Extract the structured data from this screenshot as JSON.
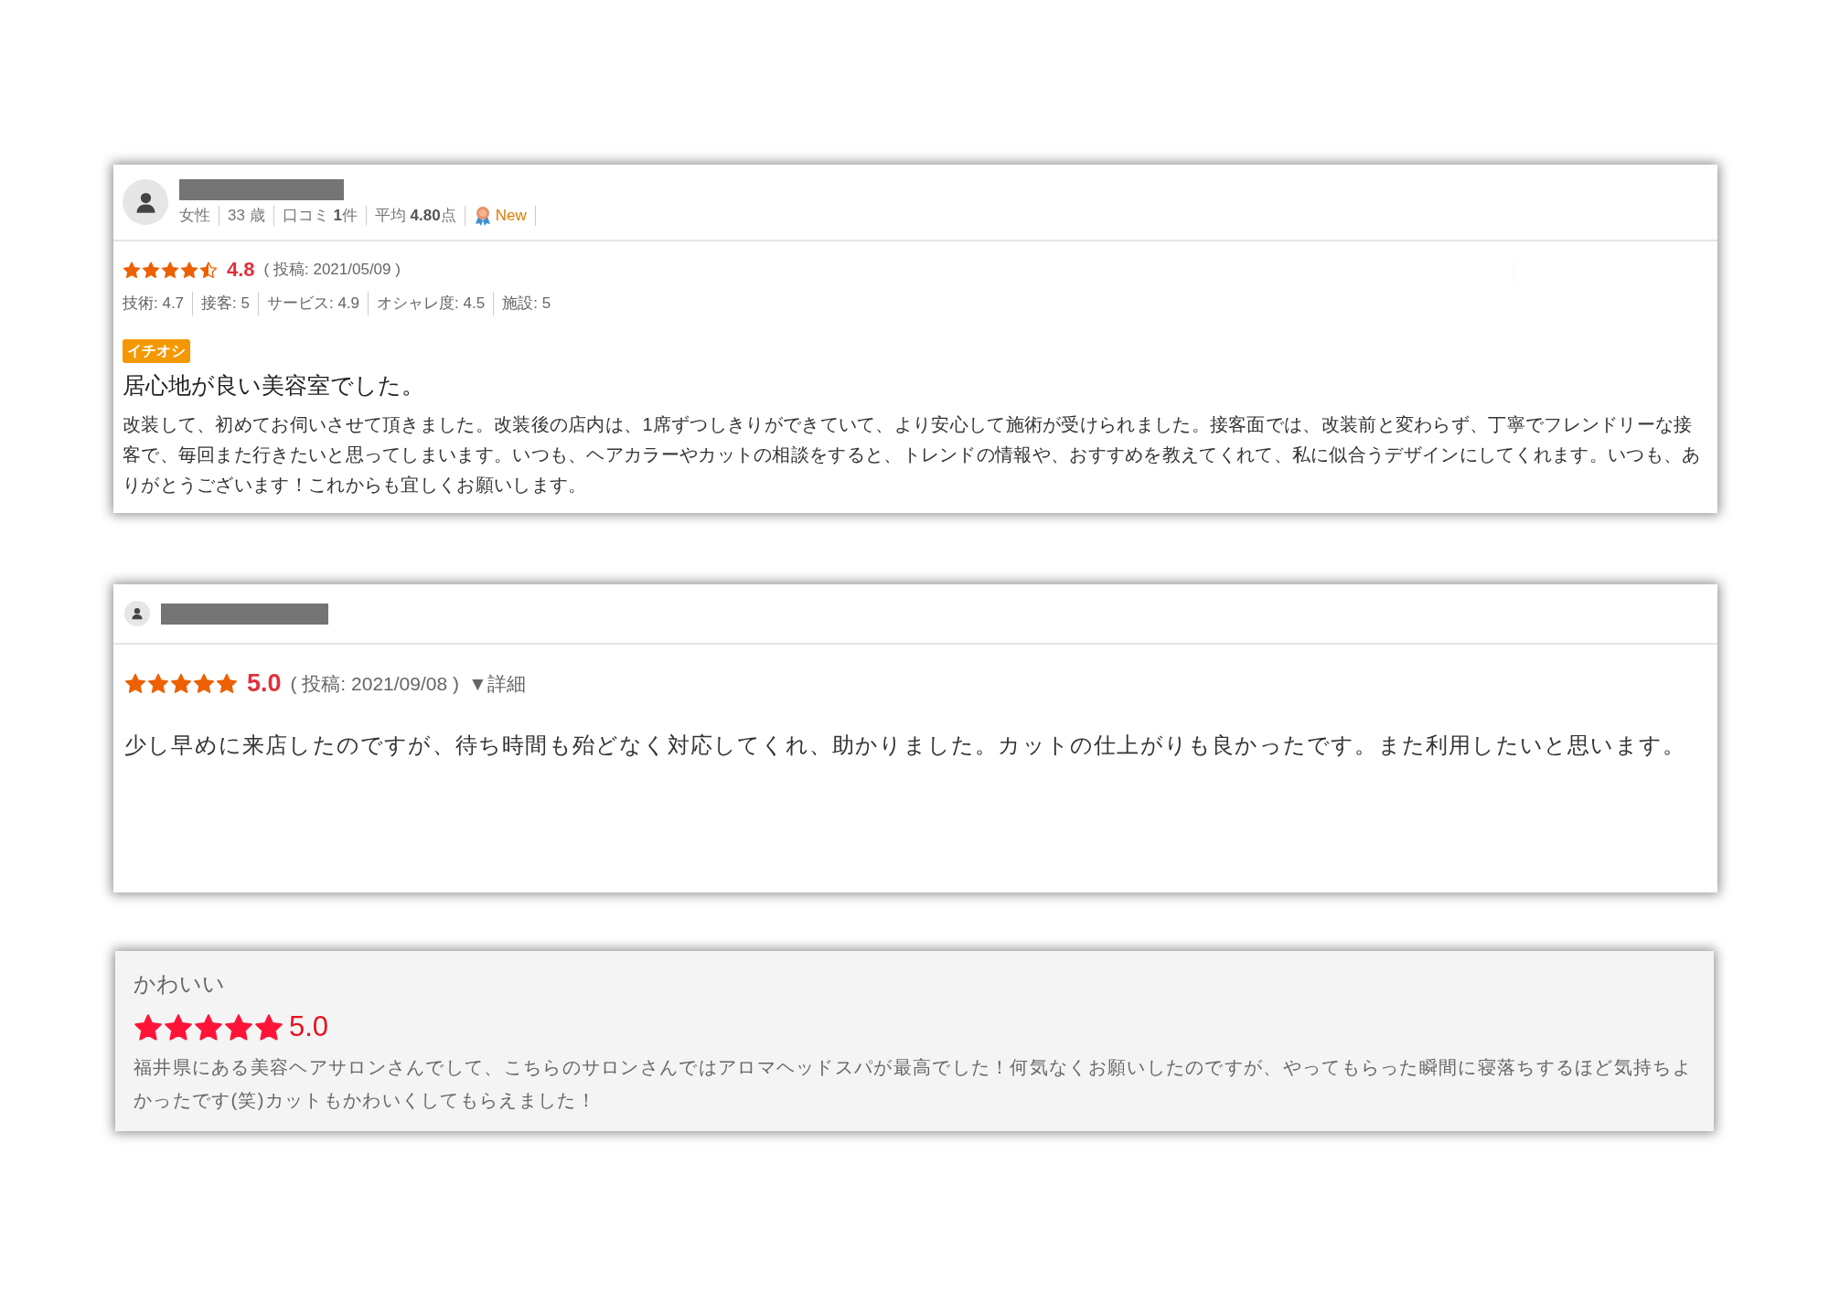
{
  "reviews": [
    {
      "kind": "detailed",
      "meta": [
        "女性",
        "33 歳",
        "口コミ **1**件",
        "平均 **4.80**点"
      ],
      "badge": "New",
      "stars": 4.5,
      "score": "4.8",
      "posted": "( 投稿: 2021/05/09 )",
      "sub_scores": [
        "技術: 4.7",
        "接客: 5",
        "サービス: 4.9",
        "オシャレ度: 4.5",
        "施設: 5"
      ],
      "tag": "イチオシ",
      "title": "居心地が良い美容室でした。",
      "body": "改装して、初めてお伺いさせて頂きました。改装後の店内は、1席ずつしきりができていて、より安心して施術が受けられました。接客面では、改装前と変わらず、丁寧でフレンドリーな接客で、毎回また行きたいと思ってしまいます。いつも、ヘアカラーやカットの相談をすると、トレンドの情報や、おすすめを教えてくれて、私に似合うデザインにしてくれます。いつも、ありがとうございます！これからも宜しくお願いします。"
    },
    {
      "kind": "simple",
      "stars": 5,
      "score": "5.0",
      "posted": "( 投稿: 2021/09/08 )",
      "details_link": "▼詳細",
      "body": "少し早めに来店したのですが、待ち時間も殆どなく対応してくれ、助かりました。カットの仕上がりも良かったです。また利用したいと思います。"
    },
    {
      "kind": "plain",
      "title": "かわいい",
      "stars": 5,
      "score": "5.0",
      "body": "福井県にある美容ヘアサロンさんでして、こちらのサロンさんではアロマヘッドスパが最高でした！何気なくお願いしたのですが、やってもらった瞬間に寝落ちするほど気持ちよかったです(笑)カットもかわいくしてもらえました！"
    }
  ]
}
